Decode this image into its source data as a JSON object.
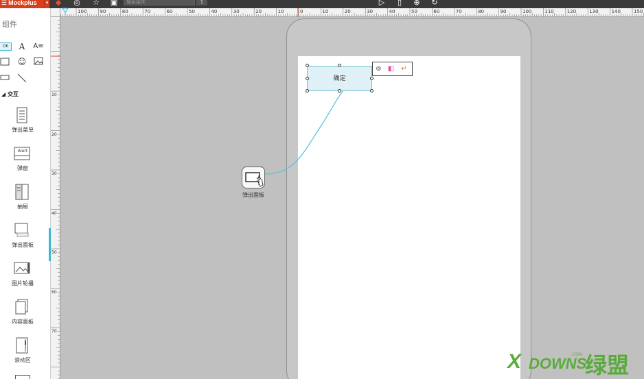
{
  "topbar": {
    "app_name": "Mockplus",
    "search_placeholder": "搜索组件",
    "page_number": "1"
  },
  "ruler": {
    "h_labels": [
      "100",
      "90",
      "80",
      "70",
      "60",
      "50",
      "40",
      "30",
      "20",
      "10",
      "0",
      "10",
      "20",
      "30",
      "40",
      "50",
      "60",
      "70",
      "80",
      "90",
      "100",
      "110",
      "120",
      "130",
      "140",
      "150"
    ],
    "v_labels": [
      "10",
      "20",
      "30",
      "40",
      "50",
      "60",
      "70"
    ]
  },
  "sidebar": {
    "title": "组件",
    "section_interaction": "交互",
    "components": [
      {
        "label": "弹出菜单",
        "icon": "popup-menu-icon"
      },
      {
        "label": "弹窗",
        "icon": "alert-icon",
        "thumb_text": "Alert"
      },
      {
        "label": "抽屉",
        "icon": "drawer-icon"
      },
      {
        "label": "弹出面板",
        "icon": "popup-panel-icon"
      },
      {
        "label": "图片轮播",
        "icon": "carousel-icon"
      },
      {
        "label": "内容面板",
        "icon": "content-panel-icon"
      },
      {
        "label": "滚动区",
        "icon": "scroll-area-icon"
      }
    ]
  },
  "canvas": {
    "button_label": "确定",
    "popup_node_label": "弹出面板"
  },
  "watermark": {
    "x": "X",
    "text": "DOWNS",
    "com": ".COM",
    "cn": "绿盟"
  },
  "colors": {
    "accent": "#3bb7d0",
    "brand": "#d8401c",
    "link_line": "#5bc3d8"
  }
}
